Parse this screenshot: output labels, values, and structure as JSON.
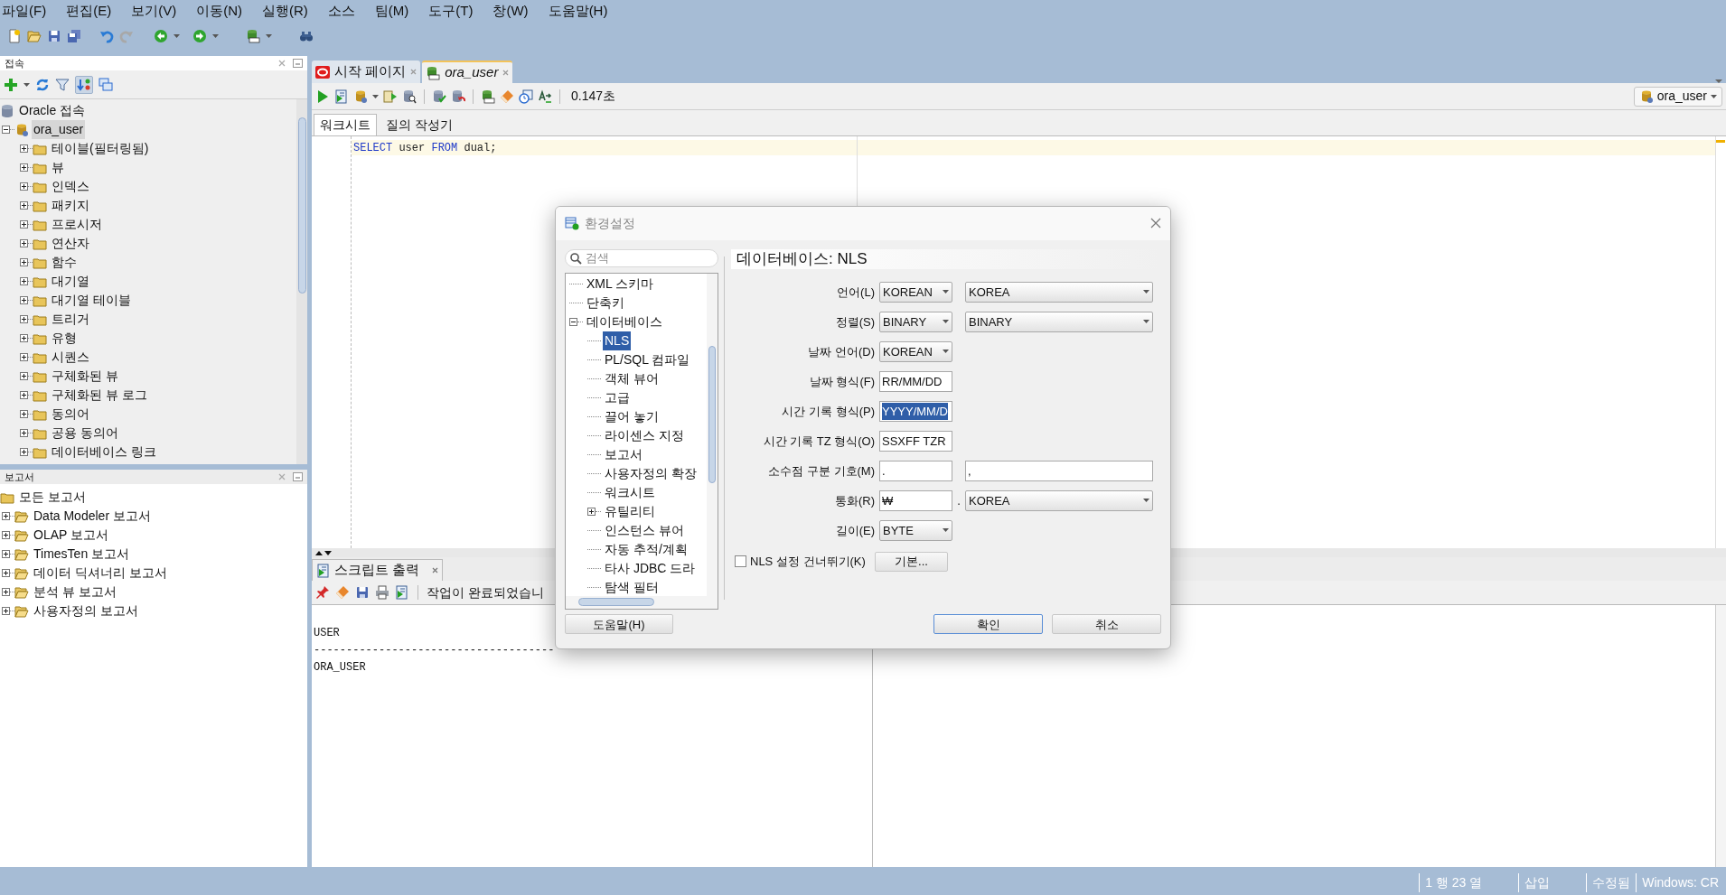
{
  "menu_bar": [
    "파일(F)",
    "편집(E)",
    "보기(V)",
    "이동(N)",
    "실행(R)",
    "소스",
    "팀(M)",
    "도구(T)",
    "창(W)",
    "도움말(H)"
  ],
  "connections_panel": {
    "title": "접속",
    "tree": [
      {
        "label": "Oracle 접속",
        "selected": false,
        "expanded": true,
        "children": [
          {
            "label": "ora_user",
            "selected": true,
            "expanded": true,
            "children": [
              {
                "label": "테이블(필터링됨)",
                "selected": false,
                "expanded": false
              },
              {
                "label": "뷰",
                "selected": false,
                "expanded": false
              },
              {
                "label": "인덱스",
                "selected": false,
                "expanded": false
              },
              {
                "label": "패키지",
                "selected": false,
                "expanded": false
              },
              {
                "label": "프로시저",
                "selected": false,
                "expanded": false
              },
              {
                "label": "연산자",
                "selected": false,
                "expanded": false
              },
              {
                "label": "함수",
                "selected": false,
                "expanded": false
              },
              {
                "label": "대기열",
                "selected": false,
                "expanded": false
              },
              {
                "label": "대기열 테이블",
                "selected": false,
                "expanded": false
              },
              {
                "label": "트리거",
                "selected": false,
                "expanded": false
              },
              {
                "label": "유형",
                "selected": false,
                "expanded": false
              },
              {
                "label": "시퀀스",
                "selected": false,
                "expanded": false
              },
              {
                "label": "구체화된 뷰",
                "selected": false,
                "expanded": false
              },
              {
                "label": "구체화된 뷰 로그",
                "selected": false,
                "expanded": false
              },
              {
                "label": "동의어",
                "selected": false,
                "expanded": false
              },
              {
                "label": "공용 동의어",
                "selected": false,
                "expanded": false
              },
              {
                "label": "데이터베이스 링크",
                "selected": false,
                "expanded": false
              }
            ]
          }
        ]
      }
    ]
  },
  "reports_panel": {
    "title": "보고서",
    "tree": [
      {
        "label": "모든 보고서",
        "selected": false,
        "children": [
          {
            "label": "Data Modeler 보고서",
            "selected": false,
            "expanded": false
          },
          {
            "label": "OLAP 보고서",
            "selected": false,
            "expanded": false
          },
          {
            "label": "TimesTen 보고서",
            "selected": false,
            "expanded": false
          },
          {
            "label": "데이터 딕셔너리 보고서",
            "selected": false,
            "expanded": false
          },
          {
            "label": "분석 뷰 보고서",
            "selected": false,
            "expanded": false
          },
          {
            "label": "사용자정의 보고서",
            "selected": false,
            "expanded": false
          }
        ]
      }
    ]
  },
  "editor_tabs": [
    {
      "label": "시작 페이지",
      "kind": "start_page",
      "selected": false
    },
    {
      "label": "ora_user",
      "kind": "worksheet",
      "selected": true
    }
  ],
  "editor": {
    "elapsed": "0.147초",
    "connection": "ora_user",
    "subtabs": [
      {
        "label": "워크시트",
        "selected": true
      },
      {
        "label": "질의 작성기",
        "selected": false
      }
    ],
    "code_lines": [
      [
        {
          "text": "SELECT",
          "kind": "keyword"
        },
        {
          "text": " user ",
          "kind": "plain"
        },
        {
          "text": "FROM",
          "kind": "keyword"
        },
        {
          "text": " dual;",
          "kind": "plain"
        }
      ]
    ]
  },
  "script_output": {
    "tab": "스크립트 출력",
    "message": "작업이 완료되었습니",
    "lines": [
      "USER",
      "-------------------------------------",
      "ORA_USER"
    ]
  },
  "status_bar": [
    "1 행 23 열",
    "삽입",
    "수정됨",
    "Windows: CR"
  ],
  "dialog": {
    "title": "환경설정",
    "search_placeholder": "검색",
    "heading": "데이터베이스: NLS",
    "tree": [
      {
        "label": "XML 스키마",
        "selected": false
      },
      {
        "label": "단축키",
        "selected": false
      },
      {
        "label": "데이터베이스",
        "selected": false,
        "expanded": true,
        "children": [
          {
            "label": "NLS",
            "selected": true
          },
          {
            "label": "PL/SQL 컴파일",
            "selected": false
          },
          {
            "label": "객체 뷰어",
            "selected": false
          },
          {
            "label": "고급",
            "selected": false
          },
          {
            "label": "끌어 놓기",
            "selected": false
          },
          {
            "label": "라이센스 지정",
            "selected": false
          },
          {
            "label": "보고서",
            "selected": false
          },
          {
            "label": "사용자정의 확장",
            "selected": false
          },
          {
            "label": "워크시트",
            "selected": false
          },
          {
            "label": "유틸리티",
            "selected": false,
            "expanded": false
          },
          {
            "label": "인스턴스 뷰어",
            "selected": false
          },
          {
            "label": "자동 추적/계획",
            "selected": false
          },
          {
            "label": "타사 JDBC 드라",
            "selected": false
          },
          {
            "label": "탐색 필터",
            "selected": false
          }
        ]
      }
    ],
    "rows": [
      {
        "label": "언어(L)",
        "fields": [
          {
            "kind": "select",
            "value": "KOREAN"
          },
          {
            "kind": "select",
            "value": "KOREA"
          }
        ]
      },
      {
        "label": "정렬(S)",
        "fields": [
          {
            "kind": "select",
            "value": "BINARY"
          },
          {
            "kind": "select",
            "value": "BINARY"
          }
        ]
      },
      {
        "label": "날짜 언어(D)",
        "fields": [
          {
            "kind": "select",
            "value": "KOREAN"
          }
        ]
      },
      {
        "label": "날짜 형식(F)",
        "fields": [
          {
            "kind": "text",
            "value": "RR/MM/DD",
            "selected": false
          }
        ]
      },
      {
        "label": "시간 기록 형식(P)",
        "fields": [
          {
            "kind": "text",
            "value": "YYYY/MM/D",
            "selected": true
          }
        ]
      },
      {
        "label": "시간 기록 TZ 형식(O)",
        "fields": [
          {
            "kind": "text",
            "value": "SSXFF TZR",
            "selected": false
          }
        ]
      },
      {
        "label": "소수점 구분 기호(M)",
        "fields": [
          {
            "kind": "text",
            "value": ".",
            "selected": false
          },
          {
            "kind": "text",
            "value": ",",
            "selected": false
          }
        ]
      },
      {
        "label": "통화(R)",
        "separator": ".",
        "fields": [
          {
            "kind": "text",
            "value": "₩",
            "selected": false
          },
          {
            "kind": "select",
            "value": "KOREA"
          }
        ]
      },
      {
        "label": "길이(E)",
        "fields": [
          {
            "kind": "select",
            "value": "BYTE"
          }
        ]
      }
    ],
    "skip_checkbox": {
      "label": "NLS 설정 건너뛰기(K)",
      "checked": false
    },
    "defaults_button": "기본...",
    "buttons": [
      {
        "label": "도움말(H)",
        "kind": "help",
        "focused": false
      },
      {
        "label": "확인",
        "kind": "ok",
        "focused": true
      },
      {
        "label": "취소",
        "kind": "cancel",
        "focused": false
      }
    ]
  }
}
